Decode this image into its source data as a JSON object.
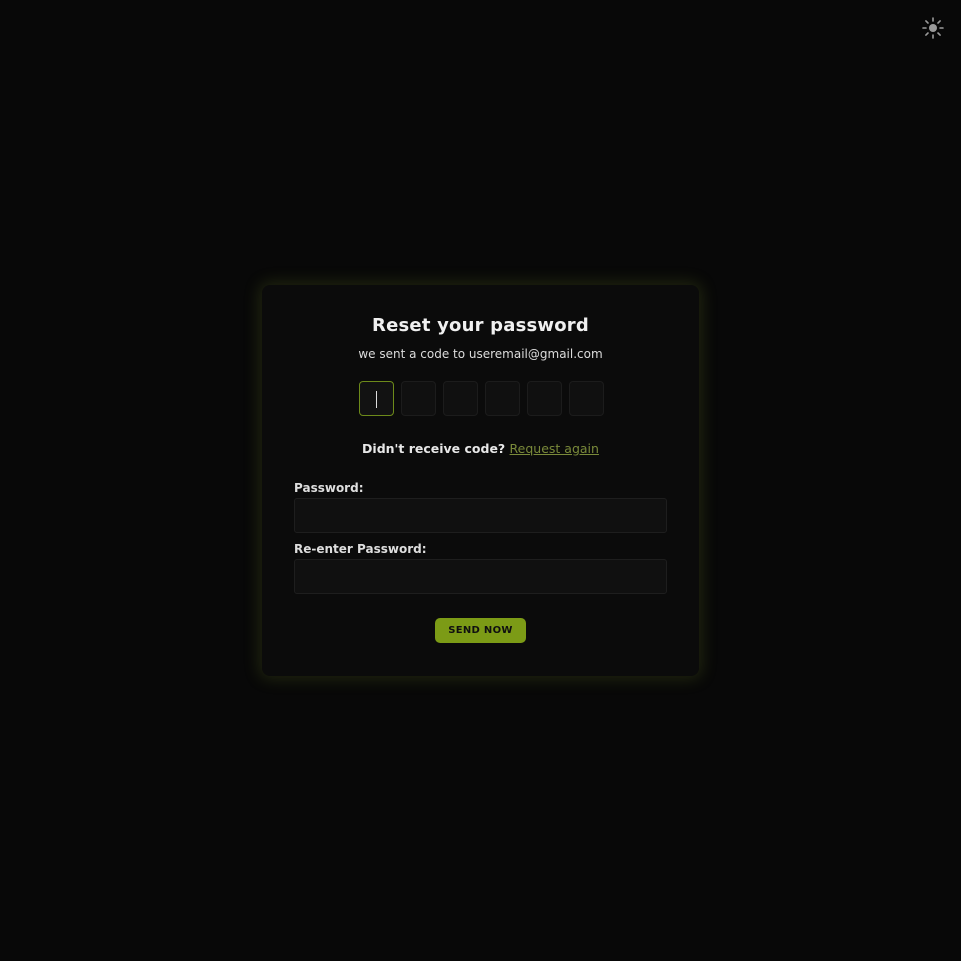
{
  "theme_toggle": {
    "icon": "sun-icon",
    "color": "#9a9a9a"
  },
  "card": {
    "title": "Reset your password",
    "subtitle": "we sent a code to useremail@gmail.com",
    "otp": {
      "length": 6,
      "active_index": 0,
      "values": [
        "",
        "",
        "",
        "",
        "",
        ""
      ]
    },
    "resend": {
      "prompt": "Didn't receive code?",
      "link_label": "Request again"
    },
    "password": {
      "label": "Password:",
      "value": "",
      "placeholder": ""
    },
    "confirm_password": {
      "label": "Re-enter Password:",
      "value": "",
      "placeholder": ""
    },
    "submit_label": "SEND NOW"
  },
  "colors": {
    "background": "#080808",
    "card": "#0b0b0b",
    "accent": "#7c9b16",
    "link": "#7a8a3a",
    "glow": "#788c28"
  }
}
